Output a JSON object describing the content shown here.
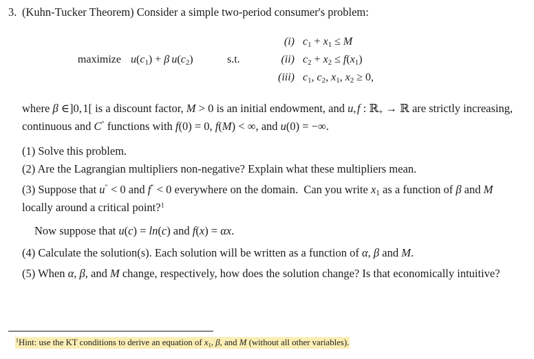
{
  "document": {
    "background_color": "#ffffff",
    "text_color": "#1b1b1b",
    "highlight_color": "#fbeeb5"
  },
  "problem": {
    "number": "3.",
    "heading": "(Kuhn-Tucker Theorem) Consider a simple two-period consumer's problem:"
  },
  "math_block": {
    "maximize_label": "maximize",
    "objective": "u(c₁) + β u(c₂)",
    "subject_to_label": "s.t.",
    "constraints": [
      {
        "label": "(i)",
        "expression": "c₁ + x₁ ≤ M"
      },
      {
        "label": "(ii)",
        "expression": "c₂ + x₂ ≤ f(x₁)"
      },
      {
        "label": "(iii)",
        "expression": "c₁, c₂, x₁, x₂ ≥ 0,"
      }
    ]
  },
  "paragraphs": {
    "where_clause": "where β ∈]0, 1[ is a discount factor, M > 0 is an initial endowment, and u, f : ℝ₊ → ℝ are strictly increasing, continuous and C″ functions with f(0) = 0, f(M) < ∞, and u(0) = −∞.",
    "now_suppose": "Now suppose that u(c) = ln(c) and f(x) = αx."
  },
  "questions": [
    {
      "label": "(1)",
      "text": "Solve this problem."
    },
    {
      "label": "(2)",
      "text": "Are the Lagrangian multipliers non-negative? Explain what these multipliers mean."
    },
    {
      "label": "(3)",
      "text": "Suppose that u″ < 0 and f″ < 0 everywhere on the domain. Can you write x₁ as a function of β and M locally around a critical point?"
    },
    {
      "label": "(4)",
      "text": "Calculate the solution(s). Each solution will be written as a function of α, β and M."
    },
    {
      "label": "(5)",
      "text": "When α, β, and M change, respectively, how does the solution change? Is that economically intuitive?"
    }
  ],
  "footnote": {
    "marker": "1",
    "lead": "Hint:",
    "text": "use the KT conditions to derive an equation of x₁, β, and M (without all other variables)."
  }
}
